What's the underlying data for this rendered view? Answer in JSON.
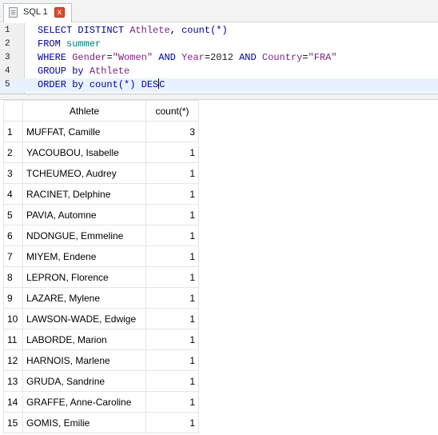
{
  "tab": {
    "label": "SQL 1",
    "close": "x"
  },
  "editor": {
    "line_numbers": [
      "1",
      "2",
      "3",
      "4",
      "5"
    ],
    "sql": {
      "l1_kw": "SELECT DISTINCT",
      "l1_col": "Athlete",
      "l1_sep": ", ",
      "l1_fn": "count(*)",
      "l2_kw": "FROM",
      "l2_tbl": "summer",
      "l3_kw": "WHERE",
      "l3_col1": "Gender",
      "l3_eq1": "=",
      "l3_val1": "\"Women\"",
      "l3_and1": "AND",
      "l3_col2": "Year",
      "l3_eq2": "=",
      "l3_val2": "2012",
      "l3_and2": "AND",
      "l3_col3": "Country",
      "l3_eq3": "=",
      "l3_val3": "\"FRA\"",
      "l4_kw": "GROUP by",
      "l4_col": "Athlete",
      "l5_kw": "ORDER by",
      "l5_fn": "count(*)",
      "l5_dir1": "DES",
      "l5_dir2": "C"
    }
  },
  "results": {
    "columns": [
      "Athlete",
      "count(*)"
    ],
    "rows": [
      {
        "n": "1",
        "athlete": "MUFFAT, Camille",
        "count": "3"
      },
      {
        "n": "2",
        "athlete": "YACOUBOU, Isabelle",
        "count": "1"
      },
      {
        "n": "3",
        "athlete": "TCHEUMEO, Audrey",
        "count": "1"
      },
      {
        "n": "4",
        "athlete": "RACINET, Delphine",
        "count": "1"
      },
      {
        "n": "5",
        "athlete": "PAVIA, Automne",
        "count": "1"
      },
      {
        "n": "6",
        "athlete": "NDONGUE, Emmeline",
        "count": "1"
      },
      {
        "n": "7",
        "athlete": "MIYEM, Endene",
        "count": "1"
      },
      {
        "n": "8",
        "athlete": "LEPRON, Florence",
        "count": "1"
      },
      {
        "n": "9",
        "athlete": "LAZARE, Mylene",
        "count": "1"
      },
      {
        "n": "10",
        "athlete": "LAWSON-WADE, Edwige",
        "count": "1"
      },
      {
        "n": "11",
        "athlete": "LABORDE, Marion",
        "count": "1"
      },
      {
        "n": "12",
        "athlete": "HARNOIS, Marlene",
        "count": "1"
      },
      {
        "n": "13",
        "athlete": "GRUDA, Sandrine",
        "count": "1"
      },
      {
        "n": "14",
        "athlete": "GRAFFE, Anne-Caroline",
        "count": "1"
      },
      {
        "n": "15",
        "athlete": "GOMIS, Emilie",
        "count": "1"
      }
    ]
  }
}
